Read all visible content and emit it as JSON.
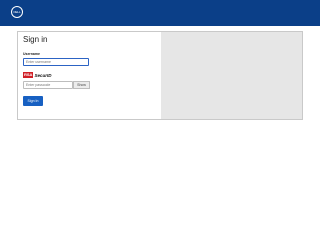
{
  "header": {
    "logo_text": "DELL",
    "color": "#0b3f88"
  },
  "form": {
    "title": "Sign in",
    "username_label": "Username",
    "username_placeholder": "Enter username",
    "rsa_badge": "RSA",
    "rsa_label": "SecurID",
    "passcode_placeholder": "Enter passcode",
    "show_label": "Show",
    "signin_label": "Sign In"
  },
  "colors": {
    "accent": "#1760c2",
    "rsa_red": "#d01f26"
  }
}
